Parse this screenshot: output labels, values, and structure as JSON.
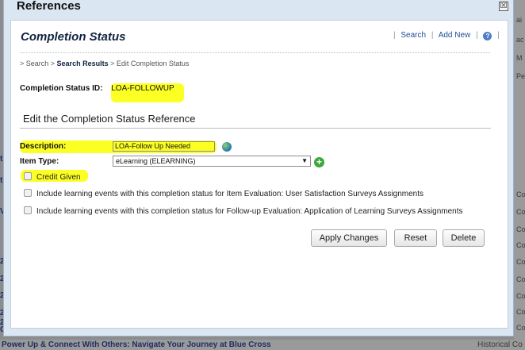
{
  "background": {
    "footer_left": "Power Up & Connect With Others:  Navigate Your Journey at Blue Cross",
    "footer_right": "Historical Co",
    "right_edge": [
      "ai",
      "ac",
      "M",
      "Pe",
      "Co",
      "Co",
      "Co",
      "Co",
      "Co",
      "Co",
      "Co",
      "Co",
      "Co"
    ],
    "left_edge": [
      "t",
      "t",
      "V",
      "2",
      "2",
      "2",
      "2",
      "2",
      "C"
    ]
  },
  "dialog": {
    "title": "References",
    "close_glyph": "☒"
  },
  "panel": {
    "heading": "Completion Status",
    "links": {
      "search": "Search",
      "add_new": "Add New",
      "help_glyph": "?",
      "separator": "|"
    },
    "breadcrumb": {
      "prefix": "> Search >",
      "search_results": "Search Results",
      "suffix": "> Edit Completion Status"
    }
  },
  "completion_id": {
    "label": "Completion Status ID:",
    "value": "LOA-FOLLOWUP"
  },
  "section": {
    "title": "Edit the Completion Status Reference"
  },
  "form": {
    "description_label": "Description:",
    "description_value": "LOA-Follow Up Needed",
    "item_type_label": "Item Type:",
    "item_type_value": "eLearning (ELEARNING)",
    "add_glyph": "+",
    "credit_given_label": "Credit Given",
    "include_item_eval_label": "Include learning events with this completion status for Item Evaluation: User Satisfaction Surveys Assignments",
    "include_followup_eval_label": "Include learning events with this completion status for Follow-up Evaluation: Application of Learning Surveys Assignments"
  },
  "buttons": {
    "apply": "Apply Changes",
    "reset": "Reset",
    "delete": "Delete"
  },
  "colors": {
    "highlight": "#fcff24",
    "dialog_bg": "#dbe6f3",
    "link": "#1f4e96"
  }
}
